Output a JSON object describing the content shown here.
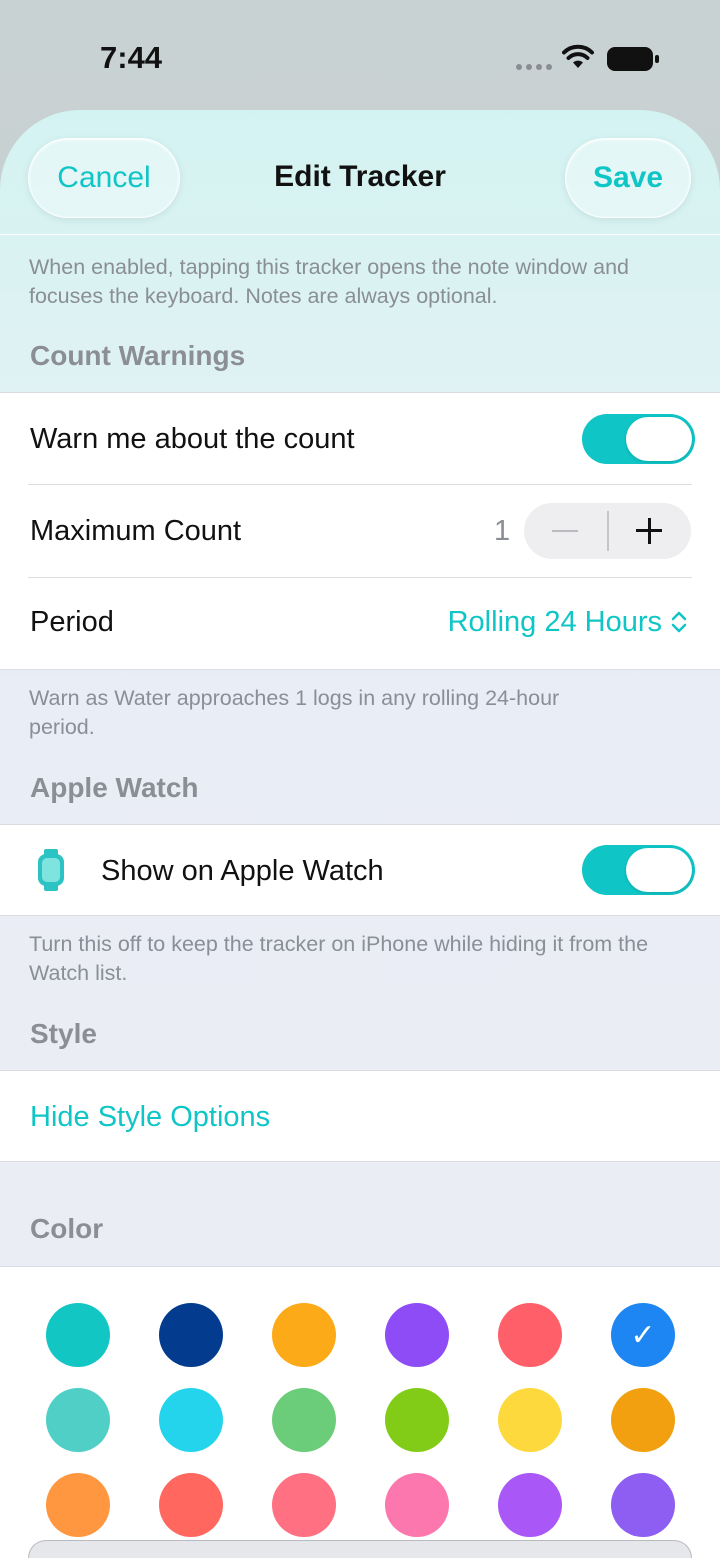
{
  "status_bar": {
    "time": "7:44"
  },
  "nav": {
    "cancel_label": "Cancel",
    "title": "Edit Tracker",
    "save_label": "Save"
  },
  "note_footer": "When enabled, tapping this tracker opens the note window and focuses the keyboard. Notes are always optional.",
  "count_warnings": {
    "header": "Count Warnings",
    "warn_label": "Warn me about the count",
    "warn_enabled": true,
    "max_label": "Maximum Count",
    "max_value": "1",
    "period_label": "Period",
    "period_value": "Rolling 24 Hours",
    "footer": "Warn as Water approaches 1 logs in any rolling 24-hour period."
  },
  "apple_watch": {
    "header": "Apple Watch",
    "show_label": "Show on Apple Watch",
    "show_enabled": true,
    "footer": "Turn this off to keep the tracker on iPhone while hiding it from the Watch list."
  },
  "style": {
    "header": "Style",
    "hide_options_label": "Hide Style Options"
  },
  "color": {
    "header": "Color",
    "selected_mark": "✓",
    "swatches": [
      "#12c6c4",
      "#033b8f",
      "#fdaa18",
      "#8e4cf6",
      "#fe5f68",
      "#1d86f2",
      "#4fcfc6",
      "#23d4ec",
      "#6bcd7a",
      "#82cb17",
      "#fed93d",
      "#f2a010",
      "#ff9740",
      "#ff675f",
      "#fe7082",
      "#fc77ae",
      "#a957f6",
      "#8e5df1"
    ],
    "selected_index": 5
  },
  "accent_color": "#10c5c6"
}
